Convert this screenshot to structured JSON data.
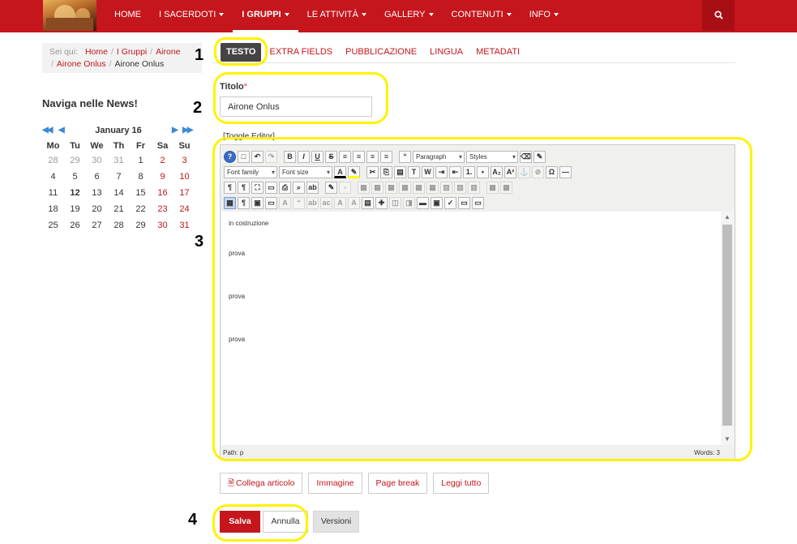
{
  "nav": {
    "items": [
      {
        "label": "HOME",
        "caret": false,
        "active": false
      },
      {
        "label": "I SACERDOTI",
        "caret": true,
        "active": false
      },
      {
        "label": "I GRUPPI",
        "caret": true,
        "active": true
      },
      {
        "label": "LE ATTIVITÀ",
        "caret": true,
        "active": false
      },
      {
        "label": "GALLERY",
        "caret": true,
        "active": false
      },
      {
        "label": "CONTENUTI",
        "caret": true,
        "active": false
      },
      {
        "label": "INFO",
        "caret": true,
        "active": false
      }
    ],
    "search_icon": "search-icon"
  },
  "breadcrumb": {
    "prefix": "Sei qui:",
    "links": [
      "Home",
      "I Gruppi",
      "Airone",
      "Airone Onlus"
    ],
    "current": "Airone Onlus"
  },
  "news": {
    "title": "Naviga nelle News!"
  },
  "calendar": {
    "month": "January 16",
    "weekdays": [
      "Mo",
      "Tu",
      "We",
      "Th",
      "Fr",
      "Sa",
      "Su"
    ],
    "days": [
      {
        "d": "28",
        "t": "o"
      },
      {
        "d": "29",
        "t": "o"
      },
      {
        "d": "30",
        "t": "o"
      },
      {
        "d": "31",
        "t": "o"
      },
      {
        "d": "1",
        "t": ""
      },
      {
        "d": "2",
        "t": "r"
      },
      {
        "d": "3",
        "t": "r"
      },
      {
        "d": "4",
        "t": ""
      },
      {
        "d": "5",
        "t": ""
      },
      {
        "d": "6",
        "t": ""
      },
      {
        "d": "7",
        "t": ""
      },
      {
        "d": "8",
        "t": ""
      },
      {
        "d": "9",
        "t": "r"
      },
      {
        "d": "10",
        "t": "r"
      },
      {
        "d": "11",
        "t": ""
      },
      {
        "d": "12",
        "t": "b"
      },
      {
        "d": "13",
        "t": ""
      },
      {
        "d": "14",
        "t": ""
      },
      {
        "d": "15",
        "t": ""
      },
      {
        "d": "16",
        "t": "r"
      },
      {
        "d": "17",
        "t": "r"
      },
      {
        "d": "18",
        "t": ""
      },
      {
        "d": "19",
        "t": ""
      },
      {
        "d": "20",
        "t": ""
      },
      {
        "d": "21",
        "t": ""
      },
      {
        "d": "22",
        "t": ""
      },
      {
        "d": "23",
        "t": "r"
      },
      {
        "d": "24",
        "t": "r"
      },
      {
        "d": "25",
        "t": ""
      },
      {
        "d": "26",
        "t": ""
      },
      {
        "d": "27",
        "t": ""
      },
      {
        "d": "28",
        "t": ""
      },
      {
        "d": "29",
        "t": ""
      },
      {
        "d": "30",
        "t": "r"
      },
      {
        "d": "31",
        "t": "r"
      }
    ]
  },
  "tabs": [
    "TESTO",
    "EXTRA FIELDS",
    "PUBBLICAZIONE",
    "LINGUA",
    "METADATI"
  ],
  "form": {
    "title_label": "Titolo",
    "title_required": "*",
    "title_value": "Airone Onlus",
    "toggle_editor": "[Toggle Editor]"
  },
  "editor": {
    "dropdowns": {
      "paragraph": "Paragraph",
      "styles": "Styles",
      "font_family": "Font family",
      "font_size": "Font size"
    },
    "content": [
      "in costruzione",
      "prova",
      "prova",
      "prova"
    ],
    "path": "Path: p",
    "words": "Words: 3"
  },
  "buttons": {
    "collega": "Collega articolo",
    "immagine": "Immagine",
    "page_break": "Page break",
    "leggi": "Leggi tutto",
    "salva": "Salva",
    "annulla": "Annulla",
    "versioni": "Versioni"
  },
  "annotations": [
    "1",
    "2",
    "3",
    "4"
  ],
  "colors": {
    "brand": "#c4161c",
    "highlight": "#fff200"
  }
}
